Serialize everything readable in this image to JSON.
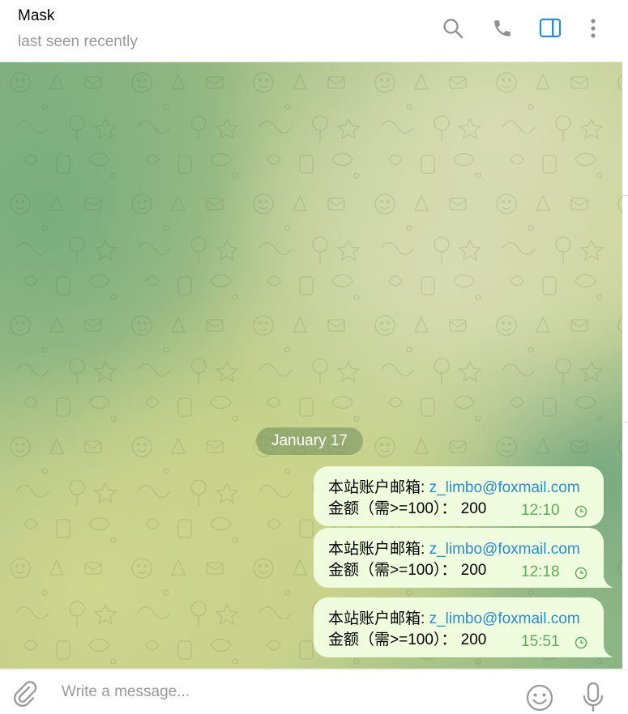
{
  "header": {
    "title": "Mask",
    "status": "last seen recently",
    "icons": [
      "search-icon",
      "phone-icon",
      "sidebar-toggle-icon",
      "more-vertical-icon"
    ]
  },
  "chat": {
    "date_label": "January 17",
    "messages": [
      {
        "label": "本站账户邮箱: ",
        "email": "z_limbo@foxmail.com",
        "amount": "金额（需>=100）： 200",
        "time": "12:10",
        "status_icon": "clock-icon"
      },
      {
        "label": "本站账户邮箱: ",
        "email": "z_limbo@foxmail.com",
        "amount": "金额（需>=100）： 200",
        "time": "12:18",
        "status_icon": "clock-icon"
      },
      {
        "label": "本站账户邮箱: ",
        "email": "z_limbo@foxmail.com",
        "amount": "金额（需>=100）： 200",
        "time": "15:51",
        "status_icon": "clock-icon"
      }
    ]
  },
  "composer": {
    "placeholder": "Write a message...",
    "icons": [
      "paperclip-icon",
      "emoji-icon",
      "microphone-icon"
    ]
  },
  "colors": {
    "accent": "#2a8bd0",
    "bubble_outgoing": "#effdde",
    "time_text": "#5fad5a",
    "status_text": "#999999"
  }
}
